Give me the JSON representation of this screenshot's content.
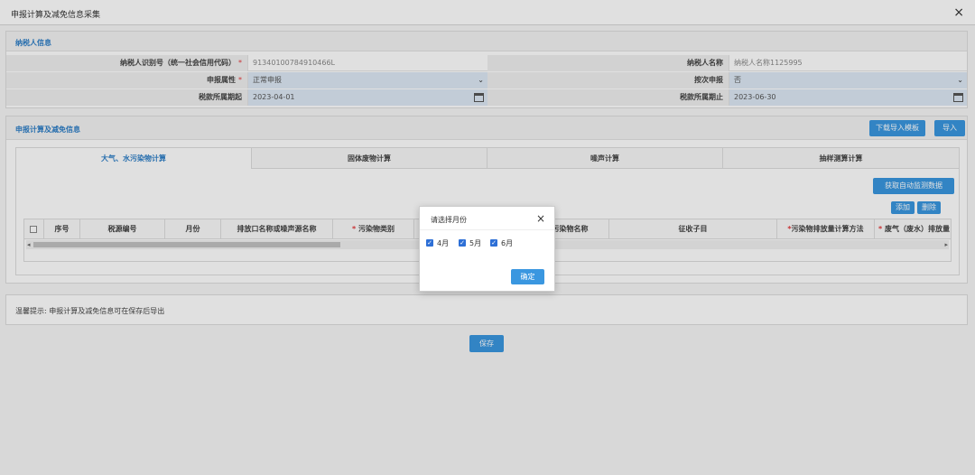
{
  "window": {
    "title": "申报计算及减免信息采集",
    "close": "×"
  },
  "taxpayer": {
    "section_title": "纳税人信息",
    "id_label": "纳税人识别号（统一社会信用代码）",
    "id_value": "91340100784910466L",
    "name_label": "纳税人名称",
    "name_value": "纳税人名称1125995",
    "attr_label": "申报属性",
    "attr_value": "正常申报",
    "per_label": "按次申报",
    "per_value": "否",
    "start_label": "税款所属期起",
    "start_value": "2023-04-01",
    "end_label": "税款所属期止",
    "end_value": "2023-06-30",
    "required_mark": "*"
  },
  "calc": {
    "section_title": "申报计算及减免信息",
    "download_template": "下载导入模板",
    "import": "导入",
    "tabs": [
      "大气、水污染物计算",
      "固体废物计算",
      "噪声计算",
      "抽样测算计算"
    ],
    "fetch_button": "获取自动监测数据",
    "add_button": "添加",
    "delete_button": "删除",
    "columns": [
      "序号",
      "税源编号",
      "月份",
      "排放口名称或噪声源名称",
      "污染物类别",
      "",
      "污染物名称",
      "征收子目",
      "污染物排放量计算方法",
      "废气（废水）排放量"
    ]
  },
  "tip": "温馨提示: 申报计算及减免信息可在保存后导出",
  "save_button": "保存",
  "dialog": {
    "title": "请选择月份",
    "close": "×",
    "options": [
      {
        "label": "4月",
        "checked": true
      },
      {
        "label": "5月",
        "checked": true
      },
      {
        "label": "6月",
        "checked": true
      }
    ],
    "ok": "确定"
  },
  "colors": {
    "accent": "#3a97e0",
    "title_blue": "#2d7ec6",
    "required": "#e4393c"
  }
}
